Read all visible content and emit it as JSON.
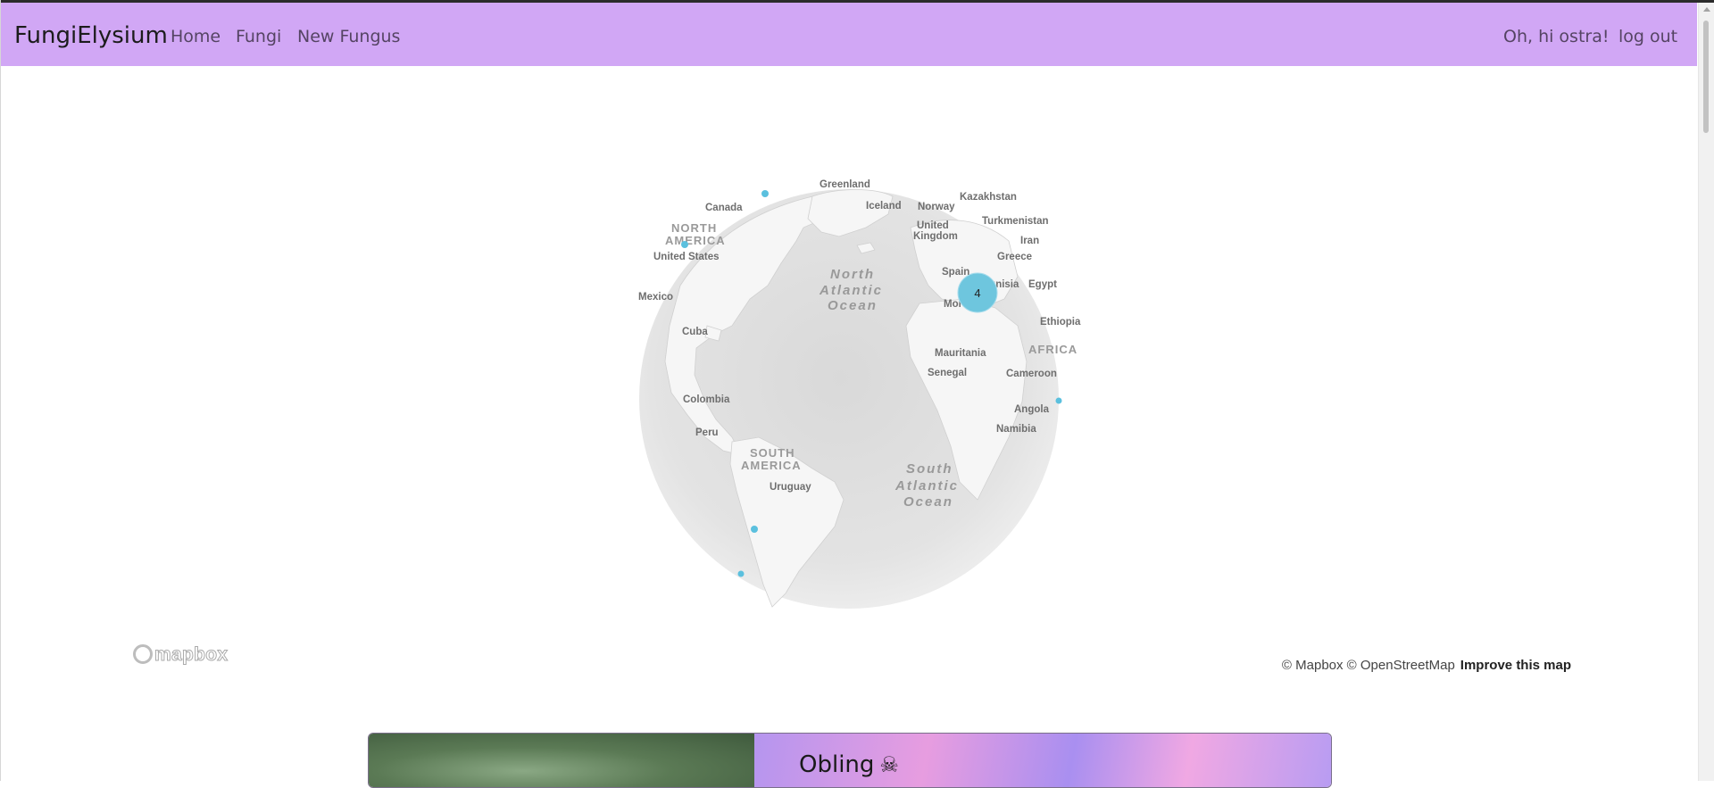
{
  "navbar": {
    "brand": "FungiElysium",
    "links": [
      "Home",
      "Fungi",
      "New Fungus"
    ],
    "greeting": "Oh, hi ostra!",
    "logout": "log out",
    "background_color": "#d1a7f5"
  },
  "map": {
    "labels": {
      "greenland": "Greenland",
      "kazakhstan": "Kazakhstan",
      "canada": "Canada",
      "iceland": "Iceland",
      "norway": "Norway",
      "turkmenistan": "Turkmenistan",
      "north_america_1": "NORTH",
      "north_america_2": "AMERICA",
      "united": "United",
      "kingdom": "Kingdom",
      "iran": "Iran",
      "united_states": "United States",
      "greece": "Greece",
      "north_atlantic_1": "North",
      "north_atlantic_2": "Atlantic",
      "north_atlantic_3": "Ocean",
      "spain": "Spain",
      "tunisia": "Tunisia",
      "egypt": "Egypt",
      "mexico": "Mexico",
      "morocco": "Morocco",
      "ethiopia": "Ethiopia",
      "cuba": "Cuba",
      "africa": "AFRICA",
      "mauritania": "Mauritania",
      "senegal": "Senegal",
      "cameroon": "Cameroon",
      "colombia": "Colombia",
      "angola": "Angola",
      "peru": "Peru",
      "namibia": "Namibia",
      "south_america_1": "SOUTH",
      "south_america_2": "AMERICA",
      "south_atlantic_1": "South",
      "south_atlantic_2": "Atlantic",
      "south_atlantic_3": "Ocean",
      "uruguay": "Uruguay"
    },
    "cluster_count": "4",
    "marker_color": "#5bc0de",
    "logo_text": "mapbox",
    "attribution": "© Mapbox © OpenStreetMap",
    "improve": "Improve this map"
  },
  "card": {
    "title": "Obling",
    "emoji": "☠"
  }
}
